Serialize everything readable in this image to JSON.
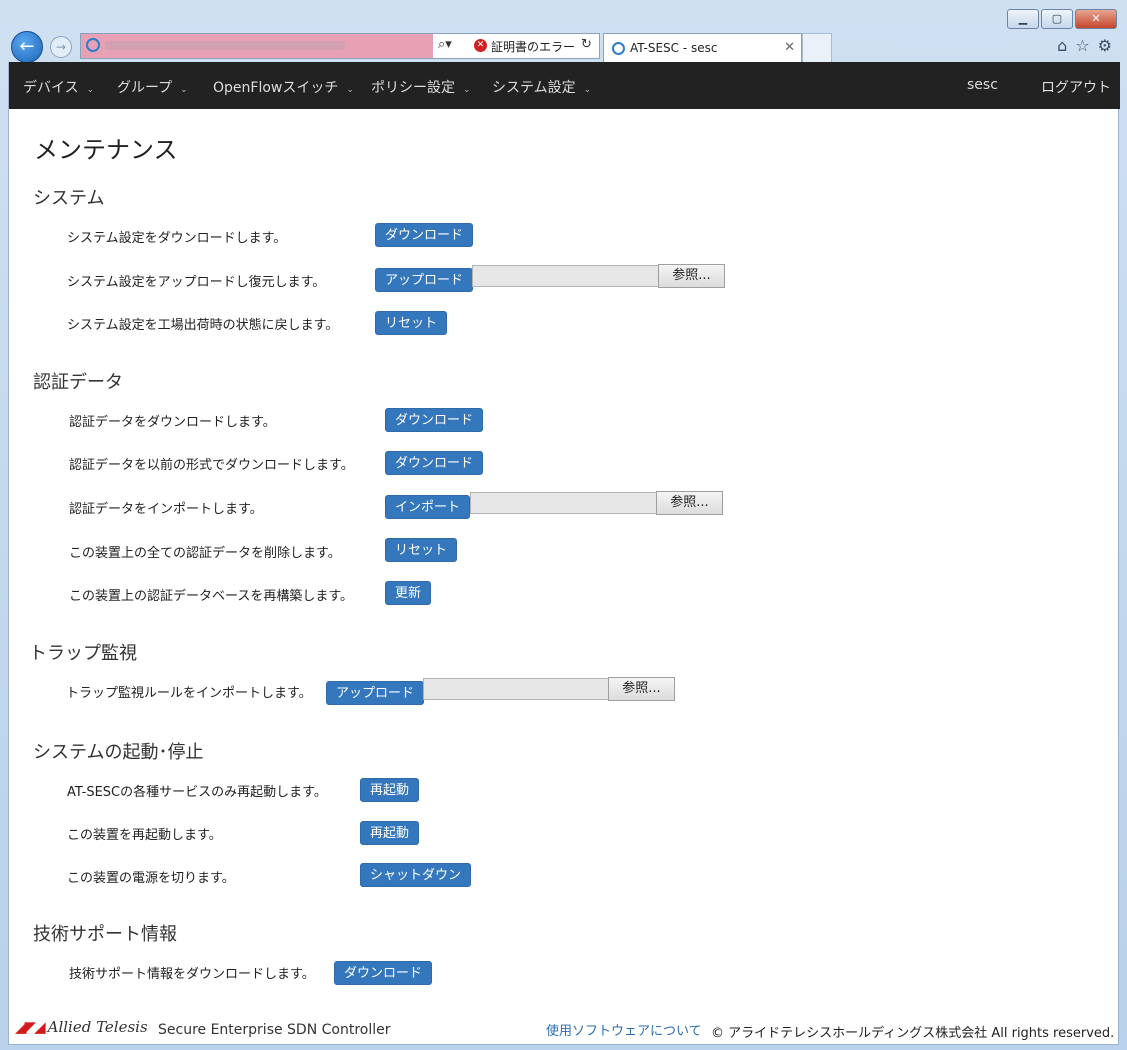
{
  "browser": {
    "address_error": "証明書のエラー",
    "tab_title": "AT-SESC - sesc"
  },
  "navbar": {
    "items": [
      "デバイス",
      "グループ",
      "OpenFlowスイッチ",
      "ポリシー設定",
      "システム設定"
    ],
    "user": "sesc",
    "logout": "ログアウト"
  },
  "page_title": "メンテナンス",
  "sections": {
    "system": {
      "heading": "システム",
      "rows": [
        {
          "label": "システム設定をダウンロードします。",
          "button": "ダウンロード"
        },
        {
          "label": "システム設定をアップロードし復元します。",
          "button": "アップロード",
          "browse": "参照..."
        },
        {
          "label": "システム設定を工場出荷時の状態に戻します。",
          "button": "リセット"
        }
      ]
    },
    "auth": {
      "heading": "認証データ",
      "rows": [
        {
          "label": "認証データをダウンロードします。",
          "button": "ダウンロード"
        },
        {
          "label": "認証データを以前の形式でダウンロードします。",
          "button": "ダウンロード"
        },
        {
          "label": "認証データをインポートします。",
          "button": "インポート",
          "browse": "参照..."
        },
        {
          "label": "この装置上の全ての認証データを削除します。",
          "button": "リセット"
        },
        {
          "label": "この装置上の認証データベースを再構築します。",
          "button": "更新"
        }
      ]
    },
    "trap": {
      "heading": "トラップ監視",
      "rows": [
        {
          "label": "トラップ監視ルールをインポートします。",
          "button": "アップロード",
          "browse": "参照..."
        }
      ]
    },
    "power": {
      "heading": "システムの起動･停止",
      "rows": [
        {
          "label": "AT-SESCの各種サービスのみ再起動します。",
          "button": "再起動"
        },
        {
          "label": "この装置を再起動します。",
          "button": "再起動"
        },
        {
          "label": "この装置の電源を切ります。",
          "button": "シャットダウン"
        }
      ]
    },
    "support": {
      "heading": "技術サポート情報",
      "rows": [
        {
          "label": "技術サポート情報をダウンロードします。",
          "button": "ダウンロード"
        }
      ]
    }
  },
  "footer": {
    "logo_text": "Allied Telesis",
    "product": "Secure Enterprise SDN Controller",
    "software_link": "使用ソフトウェアについて",
    "copyright": "© アライドテレシスホールディングス株式会社 All rights reserved."
  }
}
